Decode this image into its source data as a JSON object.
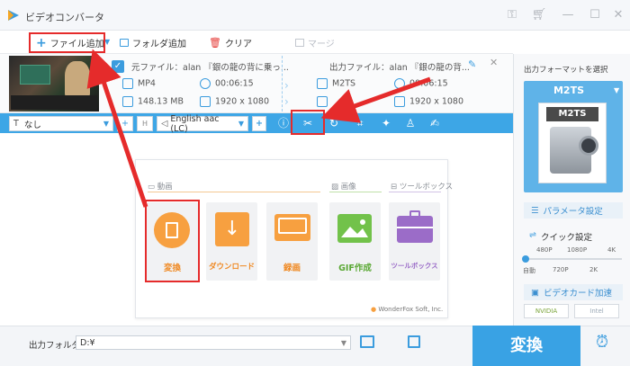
{
  "app": {
    "title": "ビデオコンバータ"
  },
  "toolbar": {
    "add_file": "ファイル追加",
    "add_folder": "フォルダ追加",
    "clear": "クリア",
    "merge": "マージ"
  },
  "file": {
    "source_label": "元ファイル：alan 『銀の龍の背に乗っ...",
    "output_label": "出力ファイル：alan 『銀の龍の背...",
    "src_format": "MP4",
    "src_duration": "00:06:15",
    "src_size": "148.13 MB",
    "src_resolution": "1920 x 1080",
    "out_format": "M2TS",
    "out_duration": "00:06:15",
    "out_size_partial": "?",
    "out_resolution": "1920 x 1080"
  },
  "controls": {
    "subtitle": "なし",
    "audio": "English aac (LC)"
  },
  "popup": {
    "section_video": "動画",
    "section_image": "画像",
    "section_toolbox": "ツールボックス",
    "tiles": [
      "変換",
      "ダウンロード",
      "録画",
      "GIF作成",
      "ツールボックス"
    ],
    "footer": "WonderFox Soft, Inc."
  },
  "right": {
    "select_format": "出力フォーマットを選択",
    "format_name": "M2TS",
    "format_badge": "M2TS",
    "param_settings": "パラメータ設定",
    "quick_settings": "クイック設定",
    "quality_top": [
      "480P",
      "1080P",
      "4K"
    ],
    "quality_bottom": [
      "自動",
      "720P",
      "2K"
    ],
    "gpu_accel": "ビデオカード加速",
    "nvidia": "NVIDIA",
    "intel": "Intel"
  },
  "bottom": {
    "output_folder_label": "出力フォルダ：",
    "output_folder_value": "D:¥",
    "convert": "変換"
  },
  "colors": {
    "accent": "#3da6e6",
    "annotation": "#e52b2b",
    "orange": "#f7a040",
    "green": "#72c24a",
    "purple": "#9b6cc8"
  }
}
